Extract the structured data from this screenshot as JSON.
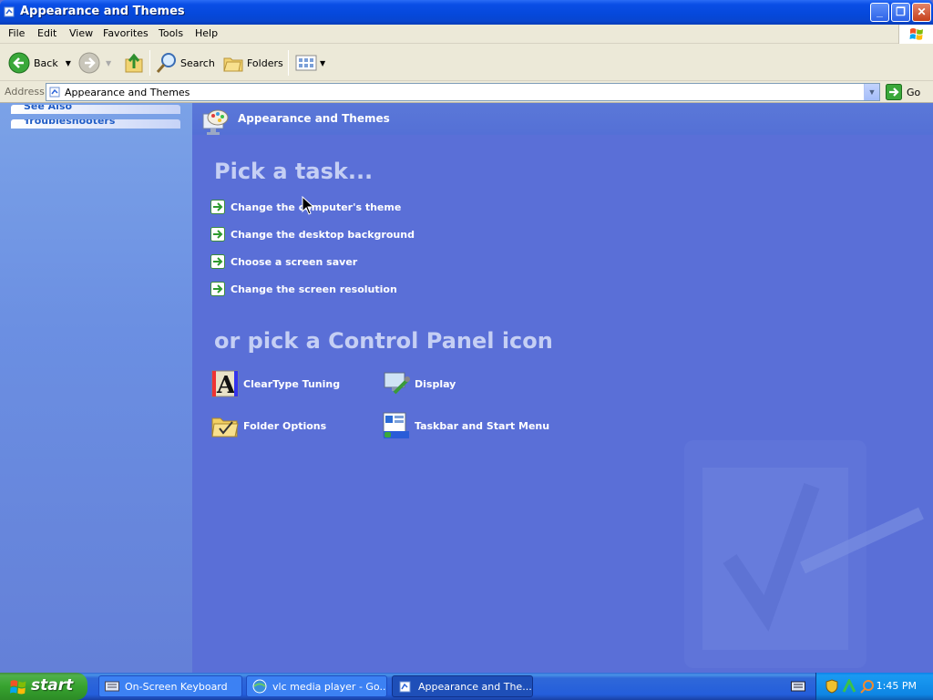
{
  "window": {
    "title": "Appearance and Themes"
  },
  "menu": [
    "File",
    "Edit",
    "View",
    "Favorites",
    "Tools",
    "Help"
  ],
  "toolbar": {
    "back": "Back",
    "search": "Search",
    "folders": "Folders"
  },
  "address": {
    "label": "Address",
    "value": "Appearance and Themes",
    "go": "Go"
  },
  "leftpane": {
    "panels": [
      "See Also",
      "Troubleshooters"
    ]
  },
  "main": {
    "header_title": "Appearance and Themes",
    "pick_task_heading": "Pick a task...",
    "tasks": [
      "Change the computer's theme",
      "Change the desktop background",
      "Choose a screen saver",
      "Change the screen resolution"
    ],
    "or_pick_heading": "or pick a Control Panel icon",
    "icons": [
      "ClearType Tuning",
      "Display",
      "Folder Options",
      "Taskbar and Start Menu"
    ]
  },
  "taskbar": {
    "start": "start",
    "items": [
      "On-Screen Keyboard",
      "vlc media player - Go...",
      "Appearance and The..."
    ],
    "active_index": 2,
    "clock": "1:45 PM"
  },
  "colors": {
    "main_bg": "#5a6fd7",
    "title_bar": "#0548da",
    "taskbar": "#245edb",
    "start_green": "#37a32f"
  }
}
